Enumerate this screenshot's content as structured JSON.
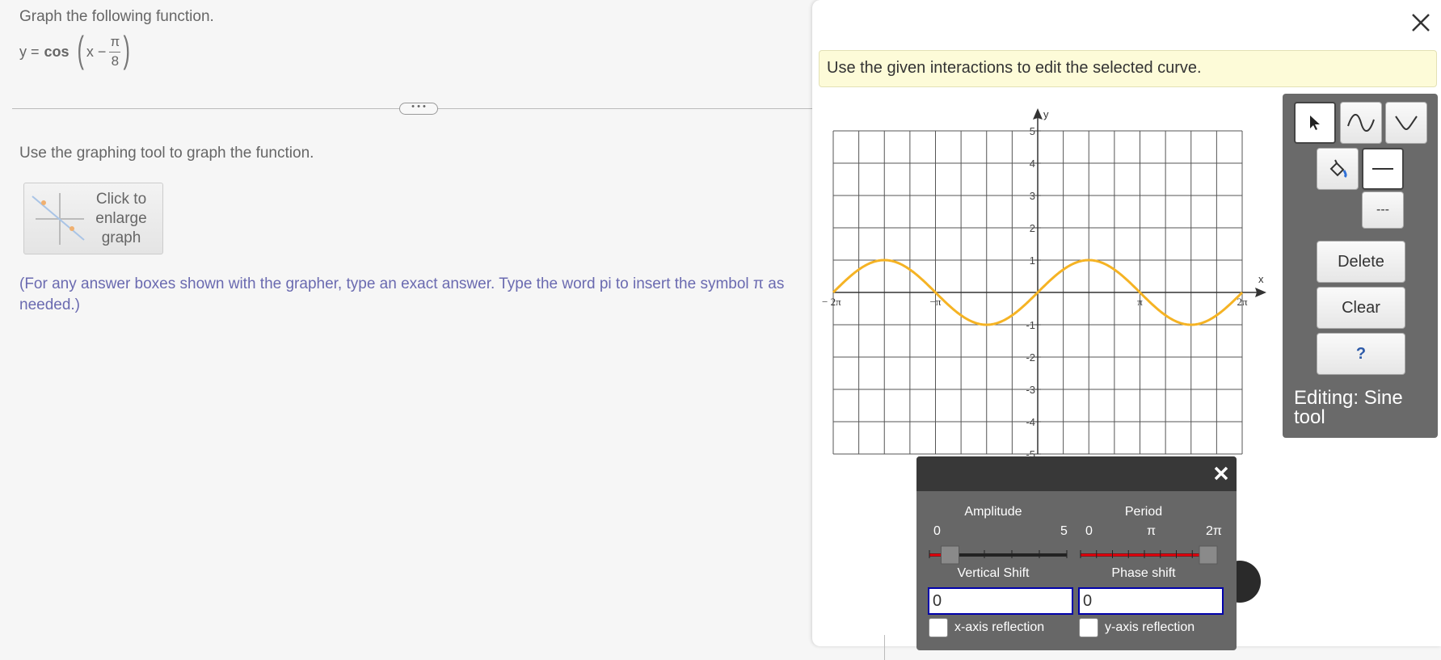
{
  "question": {
    "title": "Graph the following function.",
    "equation_lhs": "y =",
    "equation_fn": "cos",
    "equation_x": "x −",
    "equation_num": "π",
    "equation_den": "8",
    "more_label": "• • •",
    "instruction": "Use the graphing tool to graph the function.",
    "enlarge_label": "Click to enlarge graph",
    "note": "(For any answer boxes shown with the grapher, type an exact answer. Type the word pi to insert the symbol π as needed.)"
  },
  "modal": {
    "hint": "Use the given interactions to edit the selected curve.",
    "toolbar": {
      "delete_label": "Delete",
      "clear_label": "Clear",
      "help_label": "?",
      "dashed_label": "---",
      "editing_label": "Editing: Sine tool"
    },
    "sine_panel": {
      "amplitude_label": "Amplitude",
      "amplitude_min": "0",
      "amplitude_max": "5",
      "amplitude_value": 0.15,
      "period_label": "Period",
      "period_min": "0",
      "period_mid": "π",
      "period_max": "2π",
      "period_value": 1.0,
      "vshift_label": "Vertical Shift",
      "vshift_value": "0",
      "phase_label": "Phase shift",
      "phase_value": "0",
      "xreflect_label": "x-axis reflection",
      "yreflect_label": "y-axis reflection"
    }
  },
  "chart_data": {
    "type": "line",
    "title": "",
    "xlabel": "x",
    "ylabel": "y",
    "xlim": [
      -6.283,
      6.283
    ],
    "ylim": [
      -5,
      5
    ],
    "x_tick_labels": [
      "− 2π",
      "−π",
      "π",
      "2π"
    ],
    "x_tick_values": [
      -6.283,
      -3.1416,
      3.1416,
      6.283
    ],
    "y_tick_labels": [
      "-5",
      "-4",
      "-3",
      "-2",
      "-1",
      "1",
      "2",
      "3",
      "4",
      "5"
    ],
    "y_tick_values": [
      -5,
      -4,
      -3,
      -2,
      -1,
      1,
      2,
      3,
      4,
      5
    ],
    "grid": true,
    "series": [
      {
        "function": "sin(x)",
        "amplitude": 1,
        "period": 6.283,
        "vertical_shift": 0,
        "phase_shift": 0,
        "color": "#f5b324"
      }
    ]
  },
  "colors": {
    "curve": "#f5b324",
    "slider_fill": "#e8000b",
    "input_border": "#0000aa",
    "toolbar_bg": "#6a6a6a"
  }
}
